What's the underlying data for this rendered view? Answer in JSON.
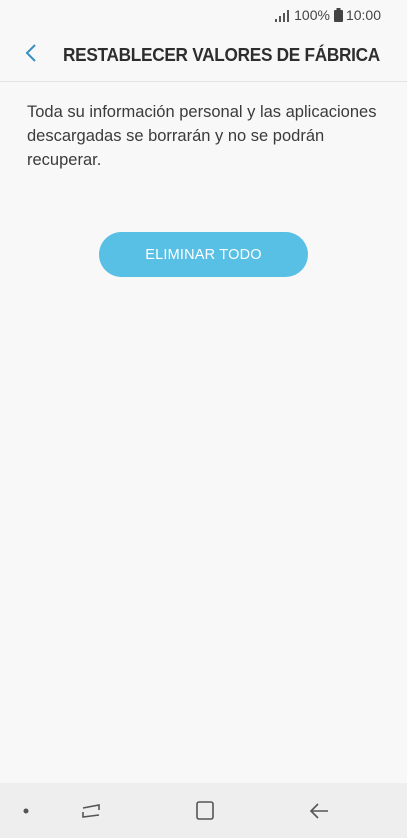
{
  "status_bar": {
    "battery_percent": "100%",
    "time": "10:00"
  },
  "header": {
    "title": "RESTABLECER VALORES DE FÁBRICA",
    "back_icon": "chevron-left-icon"
  },
  "main": {
    "description": "Toda su información personal y las aplicaciones descargadas se borrarán y no se podrán recuperar.",
    "erase_button_label": "ELIMINAR TODO"
  },
  "nav_bar": {
    "items": [
      "dot-icon",
      "recent-apps-icon",
      "home-icon",
      "back-arrow-icon"
    ]
  },
  "colors": {
    "accent": "#58bfe5",
    "back_chevron": "#3a8fc0",
    "background": "#f8f8f8",
    "nav_background": "#eeeeee"
  }
}
